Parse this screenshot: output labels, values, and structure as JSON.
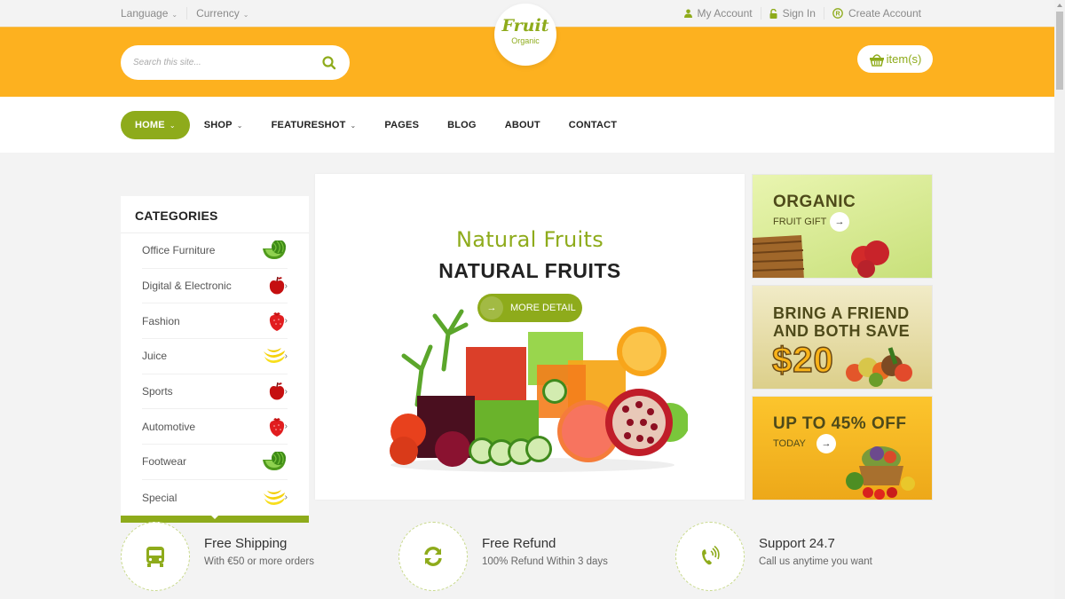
{
  "topbar": {
    "language_label": "Language",
    "currency_label": "Currency",
    "my_account": "My Account",
    "sign_in": "Sign In",
    "create_account": "Create Account"
  },
  "logo": {
    "title": "Fruit",
    "subtitle": "Organic"
  },
  "header": {
    "search_placeholder": "Search this site...",
    "cart_label": "item(s)"
  },
  "nav": {
    "items": [
      {
        "label": "HOME",
        "dropdown": true,
        "active": true
      },
      {
        "label": "SHOP",
        "dropdown": true
      },
      {
        "label": "FEATURESHOT",
        "dropdown": true
      },
      {
        "label": "PAGES",
        "dropdown": false
      },
      {
        "label": "BLOG",
        "dropdown": false
      },
      {
        "label": "ABOUT",
        "dropdown": false
      },
      {
        "label": "CONTACT",
        "dropdown": false
      }
    ]
  },
  "categories": {
    "title": "CATEGORIES",
    "items": [
      {
        "label": "Office Furniture",
        "icon": "watermelon-icon"
      },
      {
        "label": "Digital & Electronic",
        "icon": "apple-icon"
      },
      {
        "label": "Fashion",
        "icon": "strawberry-icon"
      },
      {
        "label": "Juice",
        "icon": "banana-icon"
      },
      {
        "label": "Sports",
        "icon": "apple-icon"
      },
      {
        "label": "Automotive",
        "icon": "strawberry-icon"
      },
      {
        "label": "Footwear",
        "icon": "watermelon-icon"
      },
      {
        "label": "Special",
        "icon": "banana-icon"
      }
    ]
  },
  "slider": {
    "subtitle": "Natural Fruits",
    "title": "NATURAL FRUITS",
    "button_label": "MORE DETAIL"
  },
  "promos": [
    {
      "heading": "ORGANIC",
      "sub": "FRUIT GIFT"
    },
    {
      "heading_line1": "BRING A FRIEND",
      "heading_line2": "AND BOTH SAVE",
      "amount": "$20"
    },
    {
      "heading": "UP TO 45% OFF",
      "sub": "TODAY"
    }
  ],
  "services": [
    {
      "title": "Free Shipping",
      "desc": "With €50 or more orders",
      "icon": "bus-icon"
    },
    {
      "title": "Free Refund",
      "desc": "100% Refund Within 3 days",
      "icon": "refresh-icon"
    },
    {
      "title": "Support 24.7",
      "desc": "Call us anytime you want",
      "icon": "phone-icon"
    }
  ],
  "colors": {
    "accent_green": "#8eab1b",
    "header_orange": "#fdb11f"
  }
}
